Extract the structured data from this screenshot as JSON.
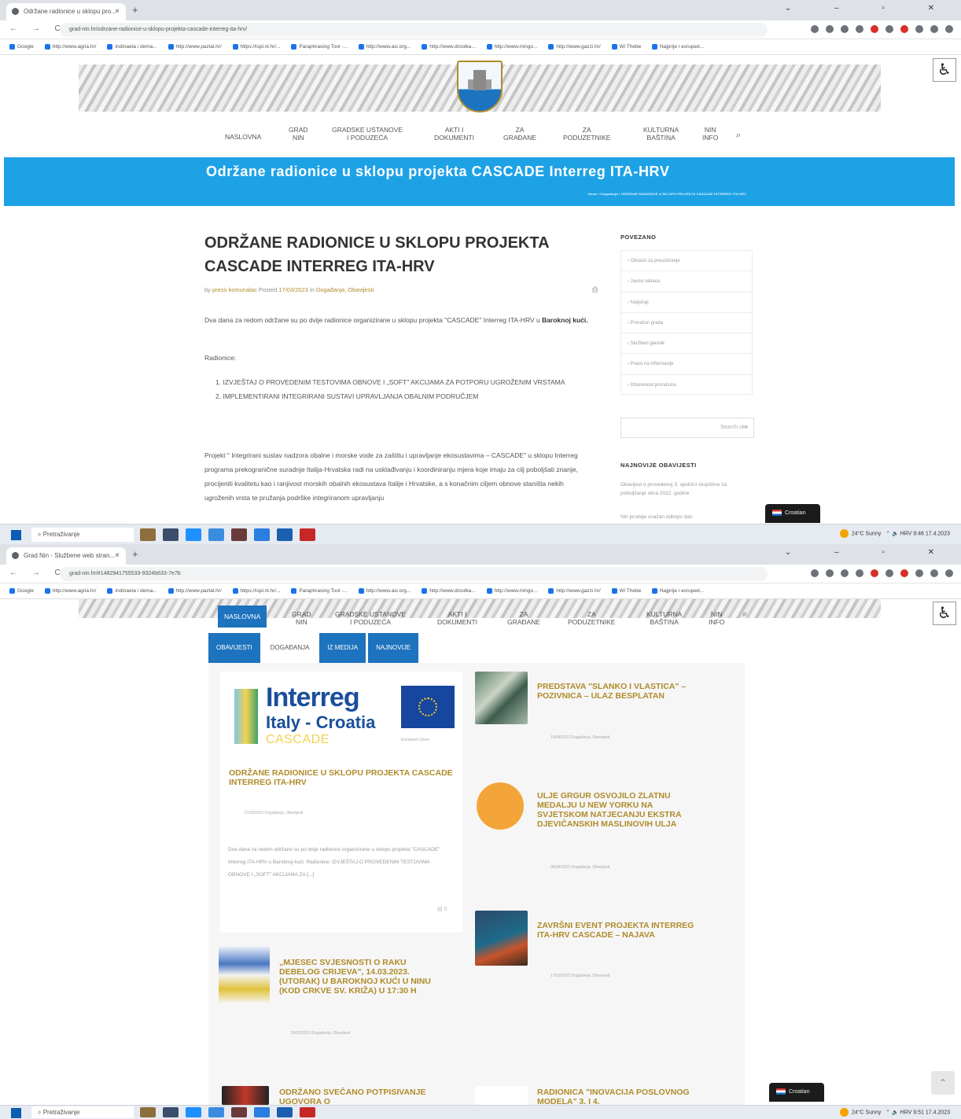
{
  "screen1": {
    "browser": {
      "tab_title": "Održane radionice u sklopu pro...",
      "url": "grad-nin.hr/odrzane-radionice-u-sklopu-projekta-cascade-interreg-ita-hrv/",
      "bookmarks": [
        "Google",
        "http://www.agria.hr/",
        "Indinaeta i dema...",
        "http://www.pazlal.hr/",
        "https://ispl.nl.hr/...",
        "Paraphrasing Tool -...",
        "http://www.asi.org...",
        "http://www.droolka...",
        "http://www.mingo...",
        "http://www.gazzi.hr/",
        "Wi Thebe",
        "Najprije i ecruped..."
      ]
    },
    "menu": [
      "NASLOVNA",
      "GRAD\nNIN",
      "GRADSKE USTANOVE\nI PODUZEĆA",
      "AKTI I\nDOKUMENTI",
      "ZA\nGRAĐANE",
      "ZA\nPODUZETNIKE",
      "KULTURNA\nBAŠTINA",
      "NIN\nINFO"
    ],
    "search_icon": "search-icon",
    "banner_title": "Održane radionice u sklopu projekta CASCADE Interreg ITA-HRV",
    "breadcrumb": "Home / Događanja / ODRŽANE RADIONICE U SKLOPU PROJEKTA CASCADE INTERREG ITA-HRV",
    "article": {
      "title": "ODRŽANE RADIONICE U SKLOPU PROJEKTA CASCADE INTERREG ITA-HRV",
      "meta_by": "by",
      "meta_author": "press komunalac",
      "meta_posted": "Posted",
      "meta_date": "17/03/2023",
      "meta_in": "in",
      "meta_cats": "Događanja, Obavijesti",
      "p1_text": "Dva dana za redom održane su po dvije radionice organizirane u sklopu projekta \"CASCADE\" Interreg ITA-HRV u",
      "p1_bold": "Baroknoj kući.",
      "p2": "Radionice:",
      "list": [
        "IZVJEŠTAJ O PROVEDENIM TESTOVIMA OBNOVE I „SOFT\" AKCIJAMA ZA POTPORU UGROŽENIM VRSTAMA",
        "IMPLEMENTIRANI INTEGRIRANI SUSTAVI UPRAVLJANJA OBALNIM PODRUČJEM"
      ],
      "p3": "Projekt \" Integrirani sustav nadzora obalne i morske vode za zaštitu i upravljanje ekosustavima – CASCADE\" u sklopu Interreg programa prekograničnе suradnje Italija-Hrvatska radi na usklađivanju i koordiniranju mjera koje imaju za cilj poboljšati znanje, procijeniti kvalitetu kao i ranjivost morskih obalnih ekosustava Italije i Hrvatske, a s konačnim ciljem obnove staništa nekih ugroženih vrsta te pružanja podrške integriranom upravljanju"
    },
    "sidebar": {
      "heading": "POVEZANO",
      "links": [
        "Obrasci za preuzimanje",
        "Javna nabava",
        "Natječaji",
        "Proračun grada",
        "Službeni glasnik",
        "Pravo na informacije",
        "Otvorenost proračuna"
      ],
      "search_placeholder": "Search site",
      "latest_heading": "NAJNOVIJE OBAVIJESTI",
      "latest_1": "Obavijest o provedenoj 3. sjednici skupštine za poboljšanje ulica 2022. godine",
      "latest_2": "Nin prodaje snažan odbojni dan"
    },
    "lang_label": "Croatian",
    "taskbar": {
      "search_text": "Pretraživanje",
      "weather": "24°C Sunny",
      "tray": "HRV",
      "time": "9:46",
      "date": "17.4.2023"
    }
  },
  "screen2": {
    "browser": {
      "tab_title": "Grad Nin - Službene web stran...",
      "url": "grad-nin.hr/#1482941755533-9324b633-7e7b"
    },
    "menu_active": "NASLOVNA",
    "news_tabs": [
      "OBAVIJESTI",
      "DOGAĐANJA",
      "IZ MEDIJA",
      "NAJNOVIJE"
    ],
    "featured": {
      "logo_interreg": "Interreg",
      "logo_region": "Italy - Croatia",
      "logo_project": "CASCADE",
      "logo_eu_caption": "European Union",
      "title": "ODRŽANE RADIONICE U SKLOPU PROJEKTA CASCADE INTERREG ITA-HRV",
      "meta": "17/03/2023 Događanja, Obavijesti",
      "excerpt": "Dva dana za redom održane su po dvije radionice organizirane u sklopu projekta \"CASCADE\" Interreg ITA-HRV u Baroknoj kući. Radionice: IZVJEŠTAJ O PROVEDENIM TESTOVIMA OBNOVE I „SOFT\" AKCIJAMA ZA [...]",
      "comments": "0"
    },
    "items": [
      {
        "title": "PREDSTAVA \"SLANKO I VLASTICA\" – POZIVNICA – ULAZ BESPLATAN",
        "meta": "14/04/2023 Događanja, Obavijesti"
      },
      {
        "title": "ULJE GRGUR OSVOJILO ZLATNU MEDALJU U NEW YORKU NA SVJETSKOM NATJECANJU EKSTRA DJEVIČANSKIH MASLINOVIH ULJA",
        "meta": "06/04/2023 Događanja, Obavijesti"
      },
      {
        "title": "ZAVRŠNI EVENT PROJEKTA INTERREG ITA-HRV CASCADE – NAJAVA",
        "meta": "17/03/2023 Događanja, Obavijesti"
      },
      {
        "title": "„MJESEC SVJESNOSTI O RAKU DEBELOG CRIJEVA\", 14.03.2023. (UTORAK) U BAROKNOJ KUĆI U NINU (KOD CRKVE SV. KRIŽA) U 17:30 H",
        "meta": "09/03/2023 Događanja, Obavijesti"
      },
      {
        "title": "ODRŽANO SVEČANO POTPISIVANJE UGOVORA O",
        "meta": ""
      },
      {
        "title": "RADIONICA \"INOVACIJA POSLOVNOG MODELA\" 3. I 4.",
        "meta": ""
      }
    ],
    "lang_label": "Croatian",
    "taskbar": {
      "search_text": "Pretraživanje",
      "weather": "24°C Sunny",
      "tray": "HRV",
      "time": "9:51",
      "date": "17.4.2023"
    }
  }
}
